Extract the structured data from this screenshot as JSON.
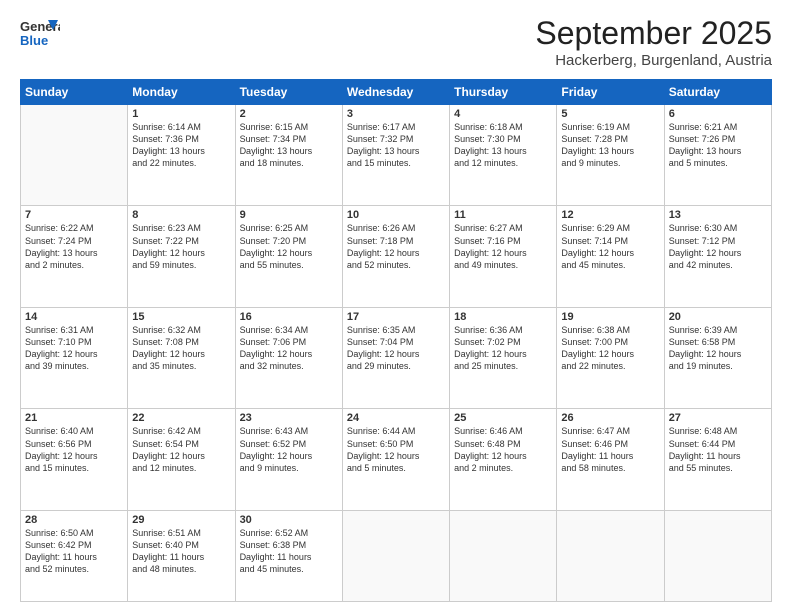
{
  "logo": {
    "general": "General",
    "blue": "Blue"
  },
  "title": "September 2025",
  "location": "Hackerberg, Burgenland, Austria",
  "days_of_week": [
    "Sunday",
    "Monday",
    "Tuesday",
    "Wednesday",
    "Thursday",
    "Friday",
    "Saturday"
  ],
  "weeks": [
    [
      {
        "day": "",
        "info": ""
      },
      {
        "day": "1",
        "info": "Sunrise: 6:14 AM\nSunset: 7:36 PM\nDaylight: 13 hours\nand 22 minutes."
      },
      {
        "day": "2",
        "info": "Sunrise: 6:15 AM\nSunset: 7:34 PM\nDaylight: 13 hours\nand 18 minutes."
      },
      {
        "day": "3",
        "info": "Sunrise: 6:17 AM\nSunset: 7:32 PM\nDaylight: 13 hours\nand 15 minutes."
      },
      {
        "day": "4",
        "info": "Sunrise: 6:18 AM\nSunset: 7:30 PM\nDaylight: 13 hours\nand 12 minutes."
      },
      {
        "day": "5",
        "info": "Sunrise: 6:19 AM\nSunset: 7:28 PM\nDaylight: 13 hours\nand 9 minutes."
      },
      {
        "day": "6",
        "info": "Sunrise: 6:21 AM\nSunset: 7:26 PM\nDaylight: 13 hours\nand 5 minutes."
      }
    ],
    [
      {
        "day": "7",
        "info": "Sunrise: 6:22 AM\nSunset: 7:24 PM\nDaylight: 13 hours\nand 2 minutes."
      },
      {
        "day": "8",
        "info": "Sunrise: 6:23 AM\nSunset: 7:22 PM\nDaylight: 12 hours\nand 59 minutes."
      },
      {
        "day": "9",
        "info": "Sunrise: 6:25 AM\nSunset: 7:20 PM\nDaylight: 12 hours\nand 55 minutes."
      },
      {
        "day": "10",
        "info": "Sunrise: 6:26 AM\nSunset: 7:18 PM\nDaylight: 12 hours\nand 52 minutes."
      },
      {
        "day": "11",
        "info": "Sunrise: 6:27 AM\nSunset: 7:16 PM\nDaylight: 12 hours\nand 49 minutes."
      },
      {
        "day": "12",
        "info": "Sunrise: 6:29 AM\nSunset: 7:14 PM\nDaylight: 12 hours\nand 45 minutes."
      },
      {
        "day": "13",
        "info": "Sunrise: 6:30 AM\nSunset: 7:12 PM\nDaylight: 12 hours\nand 42 minutes."
      }
    ],
    [
      {
        "day": "14",
        "info": "Sunrise: 6:31 AM\nSunset: 7:10 PM\nDaylight: 12 hours\nand 39 minutes."
      },
      {
        "day": "15",
        "info": "Sunrise: 6:32 AM\nSunset: 7:08 PM\nDaylight: 12 hours\nand 35 minutes."
      },
      {
        "day": "16",
        "info": "Sunrise: 6:34 AM\nSunset: 7:06 PM\nDaylight: 12 hours\nand 32 minutes."
      },
      {
        "day": "17",
        "info": "Sunrise: 6:35 AM\nSunset: 7:04 PM\nDaylight: 12 hours\nand 29 minutes."
      },
      {
        "day": "18",
        "info": "Sunrise: 6:36 AM\nSunset: 7:02 PM\nDaylight: 12 hours\nand 25 minutes."
      },
      {
        "day": "19",
        "info": "Sunrise: 6:38 AM\nSunset: 7:00 PM\nDaylight: 12 hours\nand 22 minutes."
      },
      {
        "day": "20",
        "info": "Sunrise: 6:39 AM\nSunset: 6:58 PM\nDaylight: 12 hours\nand 19 minutes."
      }
    ],
    [
      {
        "day": "21",
        "info": "Sunrise: 6:40 AM\nSunset: 6:56 PM\nDaylight: 12 hours\nand 15 minutes."
      },
      {
        "day": "22",
        "info": "Sunrise: 6:42 AM\nSunset: 6:54 PM\nDaylight: 12 hours\nand 12 minutes."
      },
      {
        "day": "23",
        "info": "Sunrise: 6:43 AM\nSunset: 6:52 PM\nDaylight: 12 hours\nand 9 minutes."
      },
      {
        "day": "24",
        "info": "Sunrise: 6:44 AM\nSunset: 6:50 PM\nDaylight: 12 hours\nand 5 minutes."
      },
      {
        "day": "25",
        "info": "Sunrise: 6:46 AM\nSunset: 6:48 PM\nDaylight: 12 hours\nand 2 minutes."
      },
      {
        "day": "26",
        "info": "Sunrise: 6:47 AM\nSunset: 6:46 PM\nDaylight: 11 hours\nand 58 minutes."
      },
      {
        "day": "27",
        "info": "Sunrise: 6:48 AM\nSunset: 6:44 PM\nDaylight: 11 hours\nand 55 minutes."
      }
    ],
    [
      {
        "day": "28",
        "info": "Sunrise: 6:50 AM\nSunset: 6:42 PM\nDaylight: 11 hours\nand 52 minutes."
      },
      {
        "day": "29",
        "info": "Sunrise: 6:51 AM\nSunset: 6:40 PM\nDaylight: 11 hours\nand 48 minutes."
      },
      {
        "day": "30",
        "info": "Sunrise: 6:52 AM\nSunset: 6:38 PM\nDaylight: 11 hours\nand 45 minutes."
      },
      {
        "day": "",
        "info": ""
      },
      {
        "day": "",
        "info": ""
      },
      {
        "day": "",
        "info": ""
      },
      {
        "day": "",
        "info": ""
      }
    ]
  ]
}
